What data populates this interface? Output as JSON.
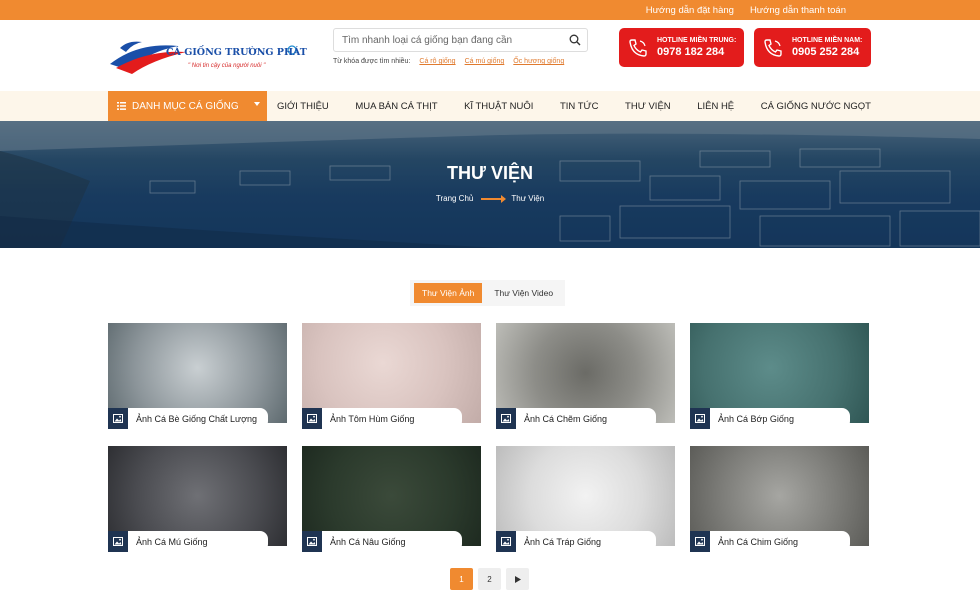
{
  "topbar": {
    "link1": "Hướng dẫn đặt hàng",
    "link2": "Hướng dẫn thanh toán"
  },
  "logo": {
    "name": "CÁ GIỐNG TRƯỜNG PHÁT",
    "slogan": "\" Nơi tin cậy của người nuôi \""
  },
  "search": {
    "placeholder": "Tìm nhanh loại cá giống bạn đang cần",
    "keywords_label": "Từ khóa được tìm nhiều:",
    "keywords": [
      "Cá rô giống",
      "Cá mú giống",
      "Ốc hương giống"
    ]
  },
  "hotlines": [
    {
      "label": "HOTLINE MIỀN TRUNG:",
      "number": "0978 182 284"
    },
    {
      "label": "HOTLINE MIỀN NAM:",
      "number": "0905 252 284"
    }
  ],
  "nav": {
    "category_button": "DANH MỤC CÁ GIỐNG",
    "items": [
      "GIỚI THIỆU",
      "MUA BÁN CÁ THỊT",
      "KĨ THUẬT NUÔI",
      "TIN TỨC",
      "THƯ VIỆN",
      "LIÊN HỆ",
      "CÁ GIỐNG NƯỚC NGỌT"
    ]
  },
  "hero": {
    "title": "THƯ VIỆN",
    "breadcrumb_home": "Trang Chủ",
    "breadcrumb_current": "Thư Viện"
  },
  "tabs": {
    "active": "Thư Viện Ảnh",
    "other": "Thư Viện Video"
  },
  "gallery": [
    {
      "caption": "Ảnh Cá Bè Giống Chất Lượng"
    },
    {
      "caption": "Ảnh Tôm Hùm Giống"
    },
    {
      "caption": "Ảnh Cá Chẽm Giống"
    },
    {
      "caption": "Ảnh Cá Bớp Giống"
    },
    {
      "caption": "Ảnh Cá Mú Giống"
    },
    {
      "caption": "Ảnh Cá Nâu Giống"
    },
    {
      "caption": "Ảnh Cá Tráp Giống"
    },
    {
      "caption": "Ảnh Cá Chim Giống"
    }
  ],
  "pagination": {
    "page1": "1",
    "page2": "2"
  },
  "colors": {
    "accent": "#f08a30",
    "hotline": "#e31c1c",
    "nav_bg": "#fdf6ea",
    "caption_icon": "#1f3452"
  }
}
